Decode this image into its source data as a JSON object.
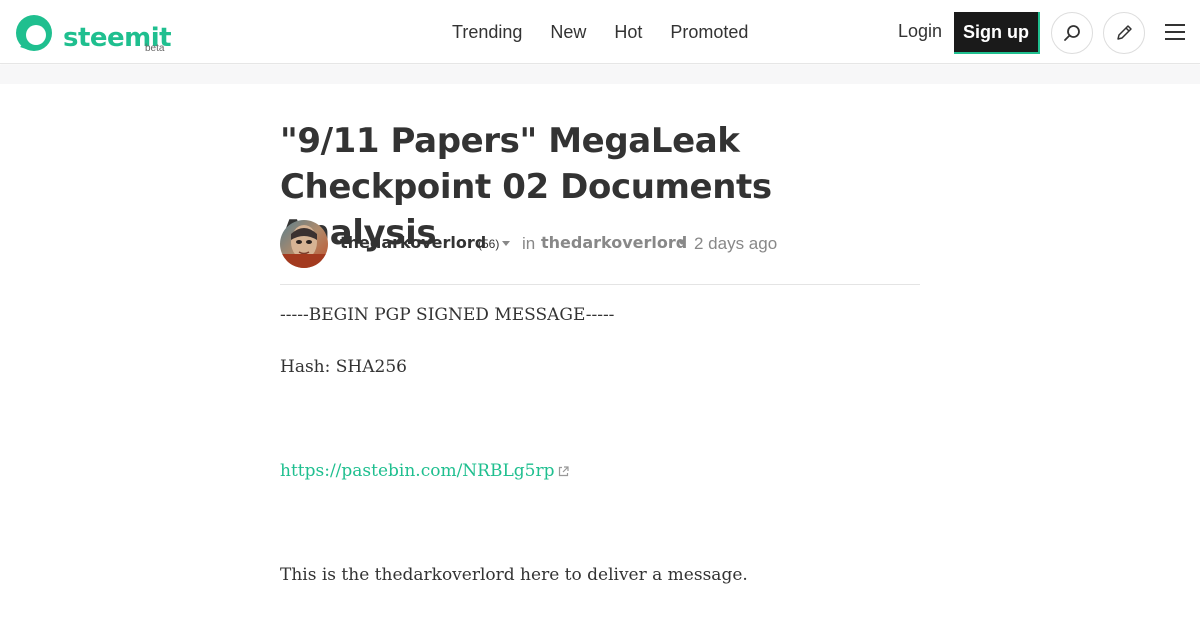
{
  "header": {
    "logo_text": "steemit",
    "logo_badge": "beta",
    "nav": [
      {
        "label": "Trending"
      },
      {
        "label": "New"
      },
      {
        "label": "Hot"
      },
      {
        "label": "Promoted"
      }
    ],
    "login_label": "Login",
    "signup_label": "Sign up",
    "icons": [
      "search-icon",
      "pencil-icon",
      "hamburger-menu-icon"
    ]
  },
  "article": {
    "title": "\"9/11 Papers\" MegaLeak Checkpoint 02 Documents Analysis",
    "author": {
      "name": "thedarkoverlord",
      "reputation": "(56)"
    },
    "in_label": "in",
    "community": "thedarkoverlord",
    "separator": "•",
    "posted": "2 days ago",
    "body": {
      "line1": "-----BEGIN PGP SIGNED MESSAGE-----",
      "line2": "Hash: SHA256",
      "link_text": "https://pastebin.com/NRBLg5rp",
      "line4": "This is the thedarkoverlord here to deliver a message."
    }
  },
  "colors": {
    "brand": "#1fbf8f",
    "text": "#333333",
    "muted": "#888888",
    "signup_bg": "#1a1a1a"
  }
}
